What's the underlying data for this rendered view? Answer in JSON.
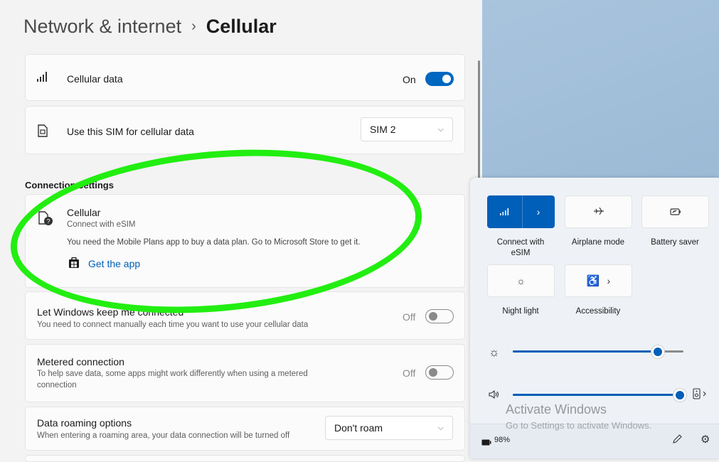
{
  "breadcrumb": {
    "parent": "Network & internet",
    "separator": "›",
    "current": "Cellular"
  },
  "cellular_data": {
    "icon": "signal-bars-icon",
    "label": "Cellular data",
    "state_label": "On",
    "enabled": true
  },
  "sim_select": {
    "icon": "sim-card-icon",
    "label": "Use this SIM for cellular data",
    "value": "SIM 2"
  },
  "section": {
    "label": "Connection settings"
  },
  "cellular_card": {
    "icon": "esim-help-icon",
    "title": "Cellular",
    "subtitle": "Connect with eSIM",
    "message": "You need the Mobile Plans app to buy a data plan. Go to Microsoft Store to get it.",
    "link_label": "Get the app"
  },
  "keep_connected": {
    "title": "Let Windows keep me connected",
    "desc": "You need to connect manually each time you want to use your cellular data",
    "state_label": "Off",
    "enabled": false
  },
  "metered": {
    "title": "Metered connection",
    "desc_line1": "To help save data, some apps might work differently when using a metered",
    "desc_line2": "connection",
    "state_label": "Off",
    "enabled": false
  },
  "roaming": {
    "title": "Data roaming options",
    "desc": "When entering a roaming area, your data connection will be turned off",
    "value": "Don't roam"
  },
  "quick_settings": {
    "tiles": [
      {
        "label_line1": "Connect with",
        "label_line2": "eSIM",
        "active": true,
        "icon": "signal-icon"
      },
      {
        "label_line1": "Airplane mode",
        "label_line2": "",
        "active": false,
        "icon": "airplane-icon"
      },
      {
        "label_line1": "Battery saver",
        "label_line2": "",
        "active": false,
        "icon": "battery-saver-icon"
      },
      {
        "label_line1": "Night light",
        "label_line2": "",
        "active": false,
        "icon": "night-light-icon"
      },
      {
        "label_line1": "Accessibility",
        "label_line2": "",
        "active": false,
        "icon": "accessibility-icon"
      }
    ],
    "brightness_percent": 85,
    "volume_percent": 100,
    "battery_label": "98%"
  },
  "watermark": {
    "title": "Activate Windows",
    "subtitle": "Go to Settings to activate Windows."
  },
  "colors": {
    "accent": "#005fb8",
    "annotation": "#22ee11"
  }
}
